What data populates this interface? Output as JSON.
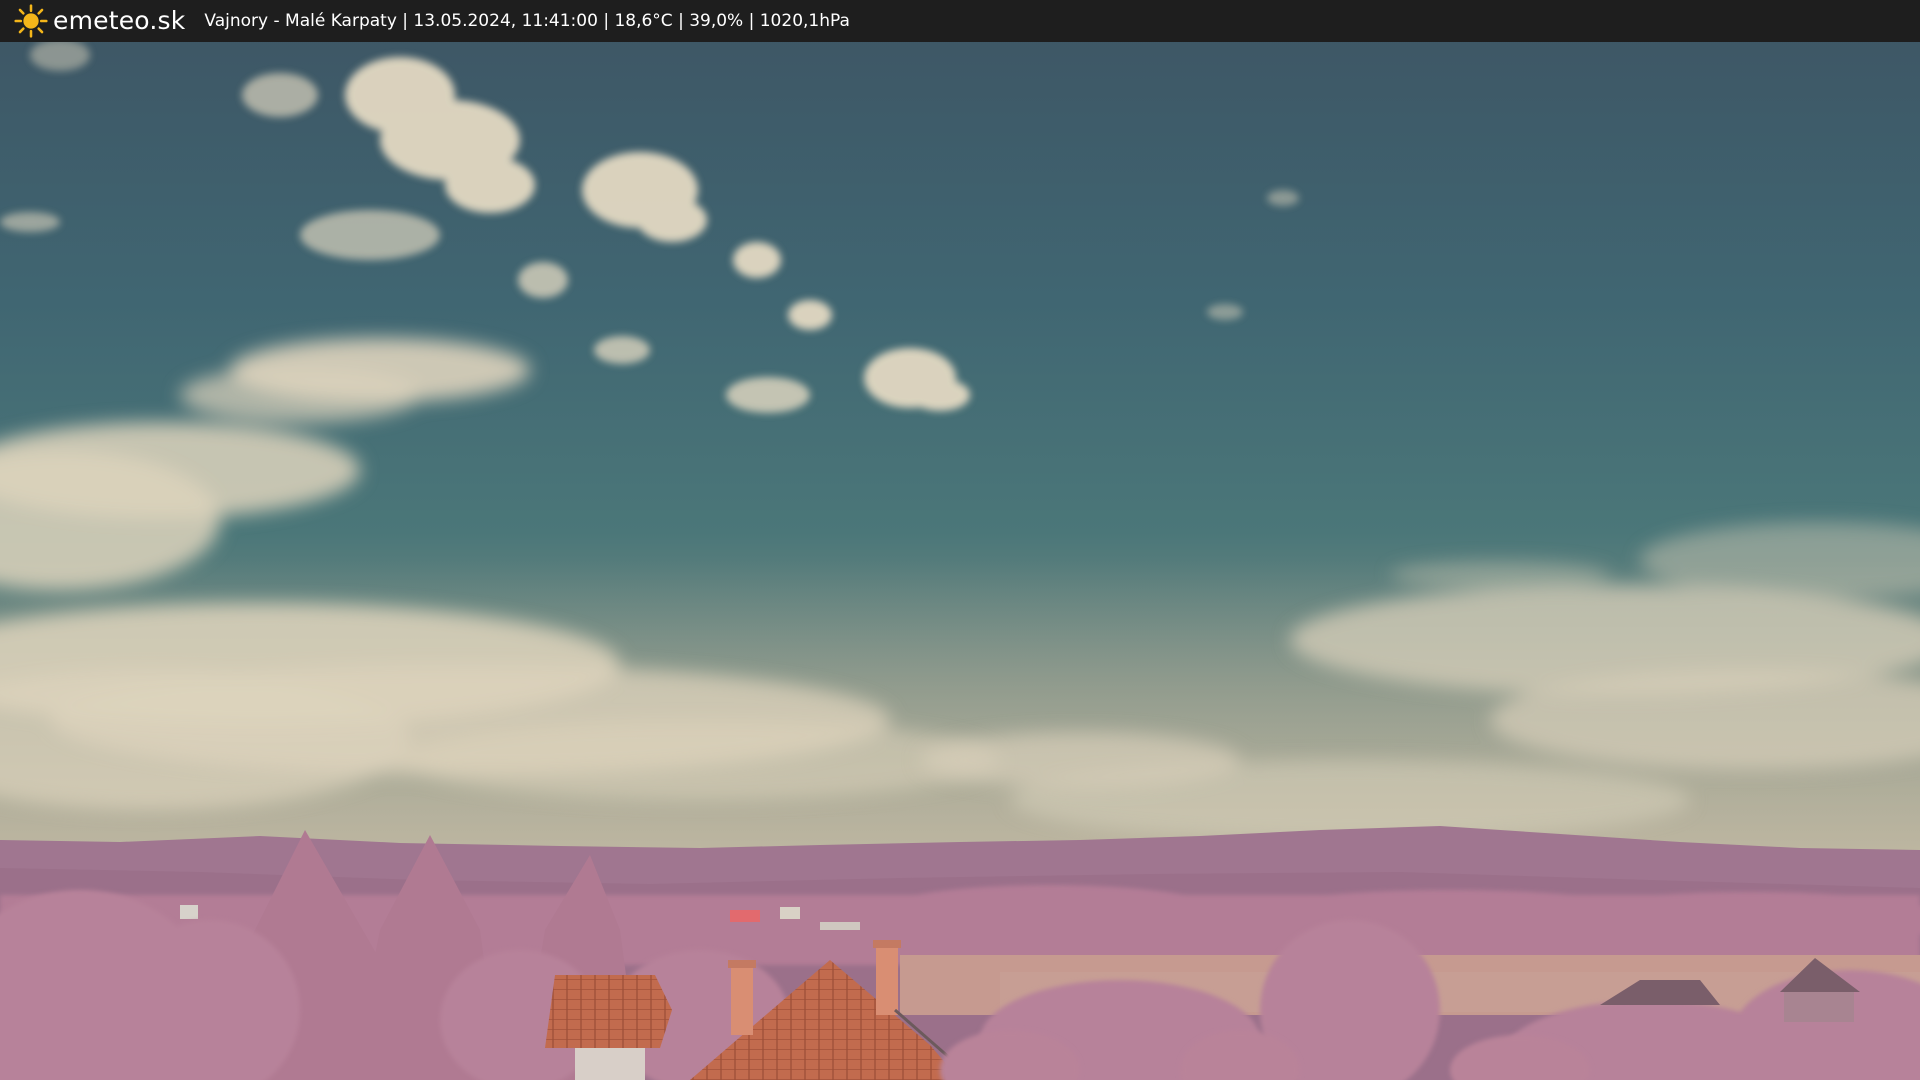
{
  "overlay": {
    "brand_name": "emeteo.sk",
    "brand_icon": "sun-icon",
    "station_info": "Vajnory - Malé Karpaty | 13.05.2024, 11:41:00 | 18,6°C | 39,0% | 1020,1hPa"
  },
  "scene": {
    "kind": "webcam-snapshot",
    "content": [
      "sky-with-cumulus-clouds",
      "wooded-hills",
      "trees",
      "tiled-rooftop-with-chimneys",
      "field"
    ],
    "colors": {
      "sky_top": "#3f5866",
      "sky_mid": "#416a74",
      "sky_horizon": "#a8a491",
      "clouds": "#e2d9c3",
      "hills": "#a5778f",
      "trees": "#b88097",
      "roof": "#c26a4d",
      "field": "#c99d92",
      "bar": "#1e1e1e",
      "sun": "#f4b61a"
    }
  }
}
